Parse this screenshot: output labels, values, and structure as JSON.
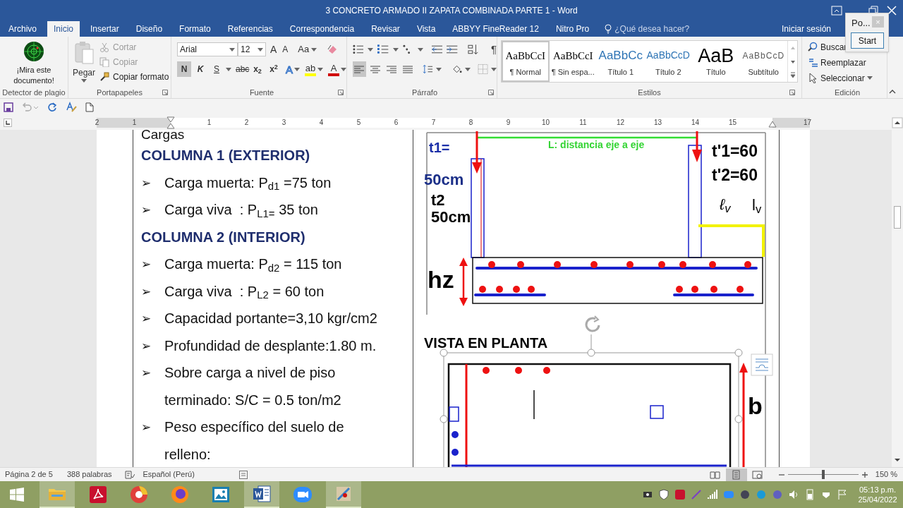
{
  "window": {
    "title": "3 CONCRETO ARMADO II ZAPATA COMBINADA PARTE 1 - Word"
  },
  "tabs": [
    {
      "label": "Archivo",
      "selected": false
    },
    {
      "label": "Inicio",
      "selected": true
    },
    {
      "label": "Insertar",
      "selected": false
    },
    {
      "label": "Diseño",
      "selected": false
    },
    {
      "label": "Formato",
      "selected": false
    },
    {
      "label": "Referencias",
      "selected": false
    },
    {
      "label": "Correspondencia",
      "selected": false
    },
    {
      "label": "Revisar",
      "selected": false
    },
    {
      "label": "Vista",
      "selected": false
    },
    {
      "label": "ABBYY FineReader 12",
      "selected": false
    },
    {
      "label": "Nitro Pro",
      "selected": false
    }
  ],
  "tell_me": {
    "placeholder": "¿Qué desea hacer?"
  },
  "account": {
    "sign_in": "Iniciar sesión"
  },
  "popup": {
    "title": "Po...",
    "close": "×",
    "button": "Start"
  },
  "ribbon": {
    "plagio": {
      "button": "¡Mira este documento!",
      "group": "Detector de plagio"
    },
    "clipboard": {
      "paste": "Pegar",
      "items": [
        {
          "label": "Cortar",
          "disabled": true
        },
        {
          "label": "Copiar",
          "disabled": true
        },
        {
          "label": "Copiar formato",
          "disabled": false
        }
      ],
      "group": "Portapapeles"
    },
    "font": {
      "family": "Arial",
      "size": "12",
      "size_buttons": [
        "A",
        "A"
      ],
      "case_button": "Aa",
      "format_buttons": [
        {
          "label": "N",
          "kind": "bold",
          "selected": true
        },
        {
          "label": "K",
          "kind": "italic",
          "selected": false
        },
        {
          "label": "S",
          "kind": "underline",
          "selected": false
        },
        {
          "label": "abc",
          "kind": "strike",
          "selected": false
        },
        {
          "label": "x$_{2}$",
          "kind": "sub",
          "selected": false
        },
        {
          "label": "x$^{2}$",
          "kind": "sup",
          "selected": false
        }
      ],
      "color_buttons": [
        {
          "label": "A",
          "kind": "effects"
        },
        {
          "label": "ab",
          "kind": "highlight"
        },
        {
          "label": "A",
          "kind": "color"
        }
      ],
      "group": "Fuente"
    },
    "paragraph": {
      "marks_button": "¶",
      "alignment": [
        {
          "selected": true
        },
        {
          "selected": false
        },
        {
          "selected": false
        },
        {
          "selected": false
        }
      ],
      "group": "Párrafo"
    },
    "styles": {
      "items": [
        {
          "preview": "AaBbCcI",
          "label": "¶ Normal",
          "kind": "normal",
          "selected": true
        },
        {
          "preview": "AaBbCcI",
          "label": "¶ Sin espa...",
          "kind": "normal",
          "selected": false
        },
        {
          "preview": "AaBbCc",
          "label": "Título 1",
          "kind": "heading1",
          "selected": false
        },
        {
          "preview": "AaBbCcD",
          "label": "Título 2",
          "kind": "heading2",
          "selected": false
        },
        {
          "preview": "AaB",
          "label": "Título",
          "kind": "title",
          "selected": false
        },
        {
          "preview": "AaBbCcD",
          "label": "Subtítulo",
          "kind": "subtitle",
          "selected": false
        }
      ],
      "group": "Estilos"
    },
    "editing": {
      "items": [
        {
          "label": "Buscar",
          "kind": "find"
        },
        {
          "label": "Reemplazar",
          "kind": "replace"
        },
        {
          "label": "Seleccionar",
          "kind": "select"
        }
      ],
      "group": "Edición"
    }
  },
  "ruler": {
    "left_labels": [
      "2",
      "1"
    ],
    "right_labels": [
      "1",
      "2",
      "3",
      "4",
      "5",
      "6",
      "7",
      "8",
      "9",
      "10",
      "11",
      "12",
      "13",
      "14",
      "15"
    ],
    "end_label": "17"
  },
  "document": {
    "left_column": [
      {
        "kind": "label",
        "text": "Cargas"
      },
      {
        "kind": "heading",
        "text": "COLUMNA 1 (EXTERIOR)"
      },
      {
        "kind": "bullet",
        "marker": "➢",
        "text": "Carga muerta: P$_{d1}$ =75 ton"
      },
      {
        "kind": "bullet",
        "marker": "➢",
        "text": "Carga viva  : P$_{L1=}$ 35 ton"
      },
      {
        "kind": "heading",
        "text": "COLUMNA 2 (INTERIOR)"
      },
      {
        "kind": "bullet",
        "marker": "➢",
        "text": "Carga muerta: P$_{d2}$ = 115 ton"
      },
      {
        "kind": "bullet",
        "marker": "➢",
        "text": "Carga viva  : P$_{L2}$ = 60 ton"
      },
      {
        "kind": "bullet",
        "marker": "➢",
        "text": "Capacidad portante=3,10 kgr/cm2"
      },
      {
        "kind": "bullet",
        "marker": "➢",
        "text": "Profundidad de desplante:1.80 m."
      },
      {
        "kind": "bullet",
        "marker": "➢",
        "text": "Sobre carga a nivel de piso terminado: S/C = 0.5 ton/m2"
      },
      {
        "kind": "bullet",
        "marker": "➢",
        "text": "Peso específico del suelo de relleno:"
      }
    ],
    "figure": {
      "labels": [
        "t1=",
        "50cm",
        "t2",
        "50cm",
        "L: distancia eje a eje",
        "t'1=60",
        "t'2=60",
        "ℓ$_{v}$",
        "l$_{v}$",
        "hz",
        "VISTA EN PLANTA",
        "b"
      ]
    }
  },
  "status_bar": {
    "page": "Página 2 de 5",
    "words": "388 palabras",
    "language": "Español (Perú)",
    "views": [
      {
        "selected": false
      },
      {
        "selected": true
      },
      {
        "selected": false
      }
    ],
    "zoom": {
      "level": 0.5,
      "reading": "150 %"
    }
  },
  "taskbar": {
    "apps": [
      {
        "kind": "explorer",
        "open": true
      },
      {
        "kind": "acrobat",
        "open": false
      },
      {
        "kind": "chrome",
        "open": false
      },
      {
        "kind": "firefox",
        "open": false
      },
      {
        "kind": "photos",
        "open": false
      },
      {
        "kind": "word",
        "open": true
      },
      {
        "kind": "zoom",
        "open": false
      },
      {
        "kind": "paint",
        "open": true
      }
    ],
    "time": "05:13 p.m.",
    "date": "25/04/2022"
  }
}
